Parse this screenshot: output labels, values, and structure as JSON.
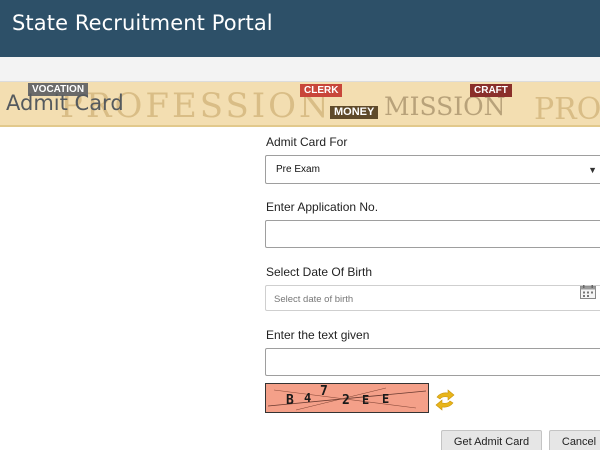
{
  "header": {
    "app_title": "State Recruitment Portal"
  },
  "banner": {
    "page_title": "Admit Card",
    "background_words": [
      "PROFESSION",
      "VOCATION",
      "CLERK",
      "MONEY",
      "MISSION",
      "CRAFT",
      "PRO"
    ]
  },
  "form": {
    "admit_card_for": {
      "label": "Admit Card For",
      "selected": "Pre Exam"
    },
    "application_no": {
      "label": "Enter Application No.",
      "value": ""
    },
    "dob": {
      "label": "Select Date Of Birth",
      "placeholder": "Select date of birth"
    },
    "captcha_text": {
      "label": "Enter the text given",
      "value": ""
    },
    "captcha_image": {
      "characters": [
        "B",
        "4",
        "7",
        "2",
        "E",
        "E"
      ]
    }
  },
  "buttons": {
    "get_admit_card": "Get Admit Card",
    "cancel": "Cancel"
  },
  "icons": {
    "calendar": "calendar-icon",
    "refresh": "refresh-captcha-icon"
  },
  "colors": {
    "header_bg": "#2d5068",
    "banner_bg": "#f3deb1",
    "captcha_bg": "#f4a089",
    "refresh_icon": "#e8b51a"
  }
}
